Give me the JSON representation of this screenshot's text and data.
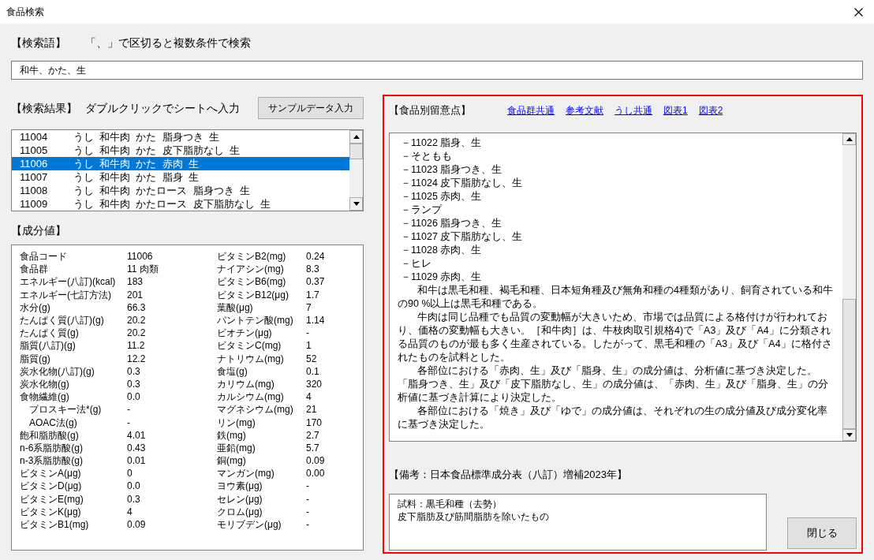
{
  "window": {
    "title": "食品検索"
  },
  "search": {
    "label": "【検索語】",
    "hint": "「、」で区切ると複数条件で検索",
    "value": "和牛、かた、生"
  },
  "results": {
    "label": "【検索結果】",
    "hint": "ダブルクリックでシートへ入力",
    "sample_button": "サンプルデータ入力",
    "rows": [
      {
        "code": "11004",
        "name": "うし 和牛肉 かた 脂身つき 生",
        "selected": false
      },
      {
        "code": "11005",
        "name": "うし 和牛肉 かた 皮下脂肪なし 生",
        "selected": false
      },
      {
        "code": "11006",
        "name": "うし 和牛肉 かた 赤肉 生",
        "selected": true
      },
      {
        "code": "11007",
        "name": "うし 和牛肉 かた 脂身 生",
        "selected": false
      },
      {
        "code": "11008",
        "name": "うし 和牛肉 かたロース 脂身つき 生",
        "selected": false
      },
      {
        "code": "11009",
        "name": "うし 和牛肉 かたロース 皮下脂肪なし 生",
        "selected": false
      }
    ]
  },
  "components": {
    "label": "【成分値】",
    "left": [
      {
        "label": "食品コード",
        "value": "11006"
      },
      {
        "label": "食品群",
        "value": "11 肉類"
      },
      {
        "label": "エネルギー(八訂)(kcal)",
        "value": "183"
      },
      {
        "label": "エネルギー(七訂方法)",
        "value": "201"
      },
      {
        "label": "水分(g)",
        "value": "66.3"
      },
      {
        "label": "たんぱく質(八訂)(g)",
        "value": "20.2"
      },
      {
        "label": "たんぱく質(g)",
        "value": "20.2"
      },
      {
        "label": "脂質(八訂)(g)",
        "value": "11.2"
      },
      {
        "label": "脂質(g)",
        "value": "12.2"
      },
      {
        "label": "炭水化物(八訂)(g)",
        "value": "0.3"
      },
      {
        "label": "炭水化物(g)",
        "value": "0.3"
      },
      {
        "label": "食物繊維(g)",
        "value": "0.0",
        "children": [
          {
            "label": "プロスキー法*(g)",
            "value": "-"
          },
          {
            "label": "AOAC法(g)",
            "value": "-"
          }
        ]
      },
      {
        "label": "飽和脂肪酸(g)",
        "value": "4.01"
      },
      {
        "label": "n-6系脂肪酸(g)",
        "value": "0.43"
      },
      {
        "label": "n-3系脂肪酸(g)",
        "value": "0.01"
      },
      {
        "label": "ビタミンA(μg)",
        "value": "0"
      },
      {
        "label": "ビタミンD(μg)",
        "value": "0.0"
      },
      {
        "label": "ビタミンE(mg)",
        "value": "0.3"
      },
      {
        "label": "ビタミンK(μg)",
        "value": "4"
      },
      {
        "label": "ビタミンB1(mg)",
        "value": "0.09"
      }
    ],
    "right": [
      {
        "label": "ビタミンB2(mg)",
        "value": "0.24"
      },
      {
        "label": "ナイアシン(mg)",
        "value": "8.3"
      },
      {
        "label": "ビタミンB6(mg)",
        "value": "0.37"
      },
      {
        "label": "ビタミンB12(μg)",
        "value": "1.7"
      },
      {
        "label": "葉酸(μg)",
        "value": "7"
      },
      {
        "label": "パントテン酸(mg)",
        "value": "1.14"
      },
      {
        "label": "ビオチン(μg)",
        "value": "-"
      },
      {
        "label": "ビタミンC(mg)",
        "value": "1"
      },
      {
        "label": "ナトリウム(mg)",
        "value": "52"
      },
      {
        "label": "食塩(g)",
        "value": "0.1"
      },
      {
        "label": "カリウム(mg)",
        "value": "320"
      },
      {
        "label": "カルシウム(mg)",
        "value": "4"
      },
      {
        "label": "マグネシウム(mg)",
        "value": "21"
      },
      {
        "label": "リン(mg)",
        "value": "170"
      },
      {
        "label": "鉄(mg)",
        "value": "2.7"
      },
      {
        "label": "亜鉛(mg)",
        "value": "5.7"
      },
      {
        "label": "銅(mg)",
        "value": "0.09"
      },
      {
        "label": "マンガン(mg)",
        "value": "0.00"
      },
      {
        "label": "ヨウ素(μg)",
        "value": "-"
      },
      {
        "label": "セレン(μg)",
        "value": "-"
      },
      {
        "label": "クロム(μg)",
        "value": "-"
      },
      {
        "label": "モリブデン(μg)",
        "value": "-"
      }
    ]
  },
  "notes": {
    "label": "【食品別留意点】",
    "links": [
      "食品群共通",
      "参考文献",
      "うし共通",
      "図表1",
      "図表2"
    ],
    "lines": [
      "－11022 脂身、生",
      "－そともも",
      "－11023 脂身つき、生",
      "－11024 皮下脂肪なし、生",
      "－11025 赤肉、生",
      "－ランプ",
      "－11026 脂身つき、生",
      "－11027 皮下脂肪なし、生",
      "－11028 赤肉、生",
      "－ヒレ",
      "－11029 赤肉、生"
    ],
    "paragraphs": [
      "和牛は黒毛和種、褐毛和種、日本短角種及び無角和種の4種類があり、飼育されている和牛の90 %以上は黒毛和種である。",
      "牛肉は同じ品種でも品質の変動幅が大きいため、市場では品質による格付けが行われており、価格の変動幅も大きい。［和牛肉］は、牛枝肉取引規格4)で「A3」及び「A4」に分類される品質のものが最も多く生産されている。したがって、黒毛和種の「A3」及び「A4」に格付されたものを試料とした。",
      "各部位における「赤肉、生」及び「脂身、生」の成分値は、分析値に基づき決定した。「脂身つき、生」及び「皮下脂肪なし、生」の成分値は、「赤肉、生」及び「脂身、生」の分析値に基づき計算により決定した。",
      "各部位における「焼き」及び「ゆで」の成分値は、それぞれの生の成分値及び成分変化率に基づき決定した。"
    ]
  },
  "remarks": {
    "label": "【備考：日本食品標準成分表（八訂）増補2023年】",
    "lines": [
      "試料：黒毛和種（去勢）",
      "皮下脂肪及び筋間脂肪を除いたもの"
    ]
  },
  "close_button": "閉じる"
}
